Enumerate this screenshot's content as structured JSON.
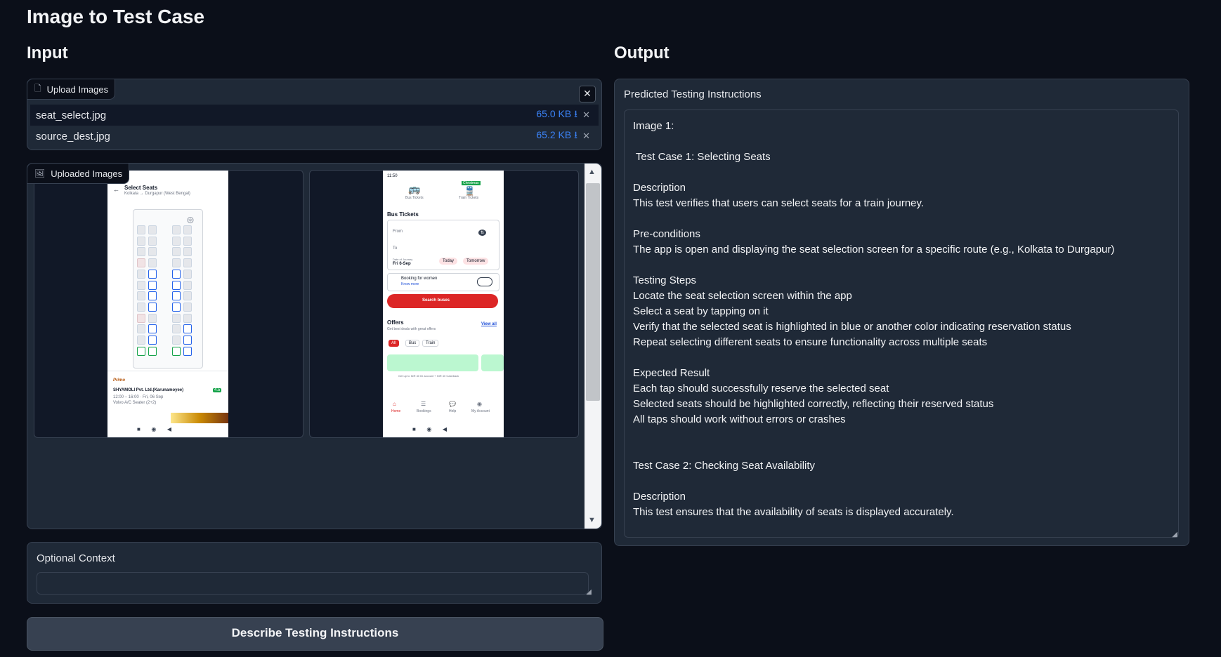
{
  "app": {
    "title": "Image to Test Case"
  },
  "input": {
    "heading": "Input",
    "upload": {
      "label": "Upload Images",
      "close_icon": "close-icon",
      "files": [
        {
          "name": "seat_select.jpg",
          "size": "65.0 KB ⭳"
        },
        {
          "name": "source_dest.jpg",
          "size": "65.2 KB ⭳"
        }
      ]
    },
    "gallery": {
      "label": "Uploaded Images",
      "seat_screen": {
        "title": "Select Seats",
        "route": "Kolkata → Durgapur (West Bengal)",
        "operator": "SHYAMOLI Pvt. Ltd.(Karunamoyee)",
        "time": "12:00 – 16:00 · Fri, 06 Sep",
        "bus_type": "Volvo A/C Seater (2+2)",
        "rating": "4.5",
        "brand": "Primo"
      },
      "bus_screen": {
        "time": "11:50",
        "tab_bus": "Bus Tickets",
        "tab_train": "Train Tickets",
        "badge": "Christmas",
        "heading": "Bus Tickets",
        "from": "From",
        "to": "To",
        "date_label": "Date of Journey",
        "date_value": "Fri 6-Sep",
        "today": "Today",
        "tomorrow": "Tomorrow",
        "women_label": "Booking for women",
        "women_link": "Know more",
        "search": "Search buses",
        "offers": "Offers",
        "offers_sub": "Get best deals with great offers",
        "view_all": "View all",
        "chip_all": "All",
        "chip_bus": "Bus",
        "chip_train": "Train",
        "promo": "Get up to INR 40 ID account + INR 40 Cashback",
        "nav_home": "Home",
        "nav_bookings": "Bookings",
        "nav_help": "Help",
        "nav_account": "My Account"
      }
    },
    "context": {
      "label": "Optional Context",
      "value": ""
    },
    "submit_label": "Describe Testing Instructions"
  },
  "output": {
    "heading": "Output",
    "label": "Predicted Testing Instructions",
    "lines": [
      "Image 1:",
      "",
      " Test Case 1: Selecting Seats",
      "",
      "Description",
      "This test verifies that users can select seats for a train journey.",
      "",
      "Pre-conditions",
      "The app is open and displaying the seat selection screen for a specific route (e.g., Kolkata to Durgapur)",
      "",
      "Testing Steps",
      "Locate the seat selection screen within the app",
      "Select a seat by tapping on it",
      "Verify that the selected seat is highlighted in blue or another color indicating reservation status",
      "Repeat selecting different seats to ensure functionality across multiple seats",
      "",
      "Expected Result",
      "Each tap should successfully reserve the selected seat",
      "Selected seats should be highlighted correctly, reflecting their reserved status",
      "All taps should work without errors or crashes",
      "",
      "",
      "Test Case 2: Checking Seat Availability",
      "",
      "Description",
      "This test ensures that the availability of seats is displayed accurately."
    ]
  }
}
